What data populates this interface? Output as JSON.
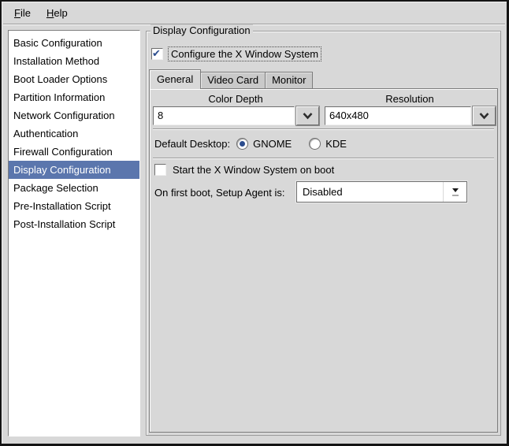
{
  "menubar": {
    "items": [
      {
        "label": "File"
      },
      {
        "label": "Help"
      }
    ]
  },
  "sidebar": {
    "items": [
      "Basic Configuration",
      "Installation Method",
      "Boot Loader Options",
      "Partition Information",
      "Network Configuration",
      "Authentication",
      "Firewall Configuration",
      "Display Configuration",
      "Package Selection",
      "Pre-Installation Script",
      "Post-Installation Script"
    ],
    "selected_index": 7
  },
  "panel": {
    "frame_title": "Display Configuration",
    "configure_x": {
      "label": "Configure the X Window System",
      "checked": true
    },
    "tabs": [
      {
        "label": "General",
        "active": true
      },
      {
        "label": "Video Card",
        "active": false
      },
      {
        "label": "Monitor",
        "active": false
      }
    ],
    "general": {
      "color_depth": {
        "label": "Color Depth",
        "value": "8"
      },
      "resolution": {
        "label": "Resolution",
        "value": "640x480"
      },
      "default_desktop": {
        "label": "Default Desktop:",
        "options": [
          {
            "label": "GNOME",
            "selected": true
          },
          {
            "label": "KDE",
            "selected": false
          }
        ]
      },
      "start_x": {
        "label": "Start the X Window System on boot",
        "checked": false
      },
      "setup_agent": {
        "label": "On first boot, Setup Agent is:",
        "value": "Disabled"
      }
    }
  },
  "icons": {
    "check_glyph": "✔"
  },
  "colors": {
    "window_bg": "#d8d8d8",
    "selection_bg": "#5b76ad",
    "selection_text": "#ffffff",
    "check_color": "#2c4d8e",
    "inactive_tab_bg": "#c9c9c9"
  }
}
